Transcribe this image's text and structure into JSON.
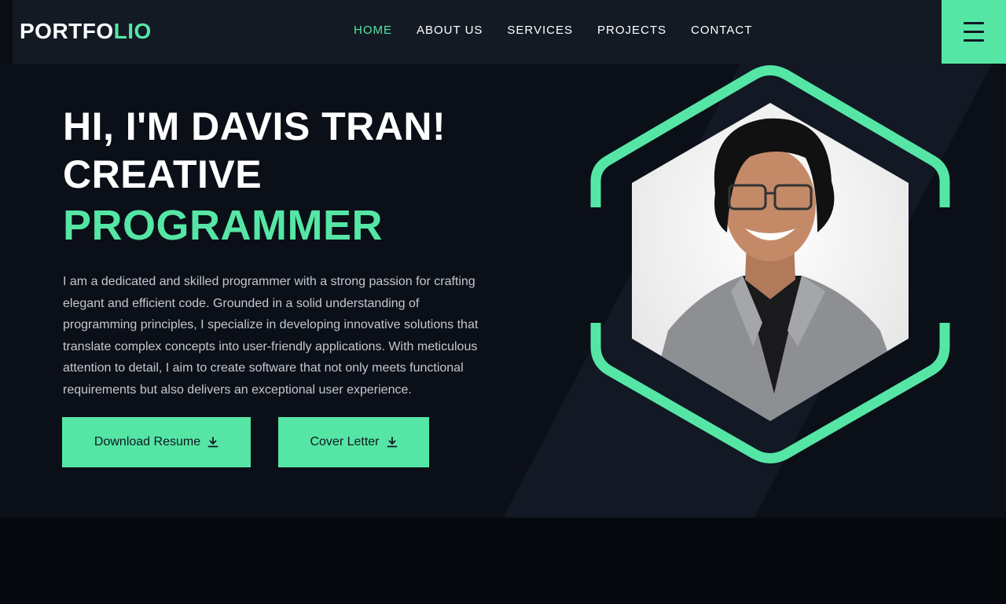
{
  "header": {
    "logo_main": "PORTFO",
    "logo_accent": "LIO",
    "nav": [
      {
        "label": "HOME",
        "active": true
      },
      {
        "label": "ABOUT US",
        "active": false
      },
      {
        "label": "SERVICES",
        "active": false
      },
      {
        "label": "PROJECTS",
        "active": false
      },
      {
        "label": "CONTACT",
        "active": false
      }
    ],
    "menu_icon": "hamburger-icon"
  },
  "hero": {
    "title_line1": "HI, I'M DAVIS TRAN!",
    "title_line2": "CREATIVE",
    "title_line3": "PROGRAMMER",
    "description": "I am a dedicated and skilled programmer with a strong passion for crafting elegant and efficient code. Grounded in a solid understanding of programming principles, I specialize in developing innovative solutions that translate complex concepts into user-friendly applications. With meticulous attention to detail, I aim to create software that not only meets functional requirements but also delivers an exceptional user experience.",
    "buttons": {
      "resume": {
        "label": "Download Resume",
        "icon": "download-icon"
      },
      "cover": {
        "label": "Cover Letter",
        "icon": "download-icon"
      }
    },
    "portrait_icon": "profile-photo"
  },
  "colors": {
    "accent": "#55e6a5",
    "header_bg": "#141a24",
    "hero_bg": "#0b0f17",
    "page_bg": "#05080d"
  }
}
